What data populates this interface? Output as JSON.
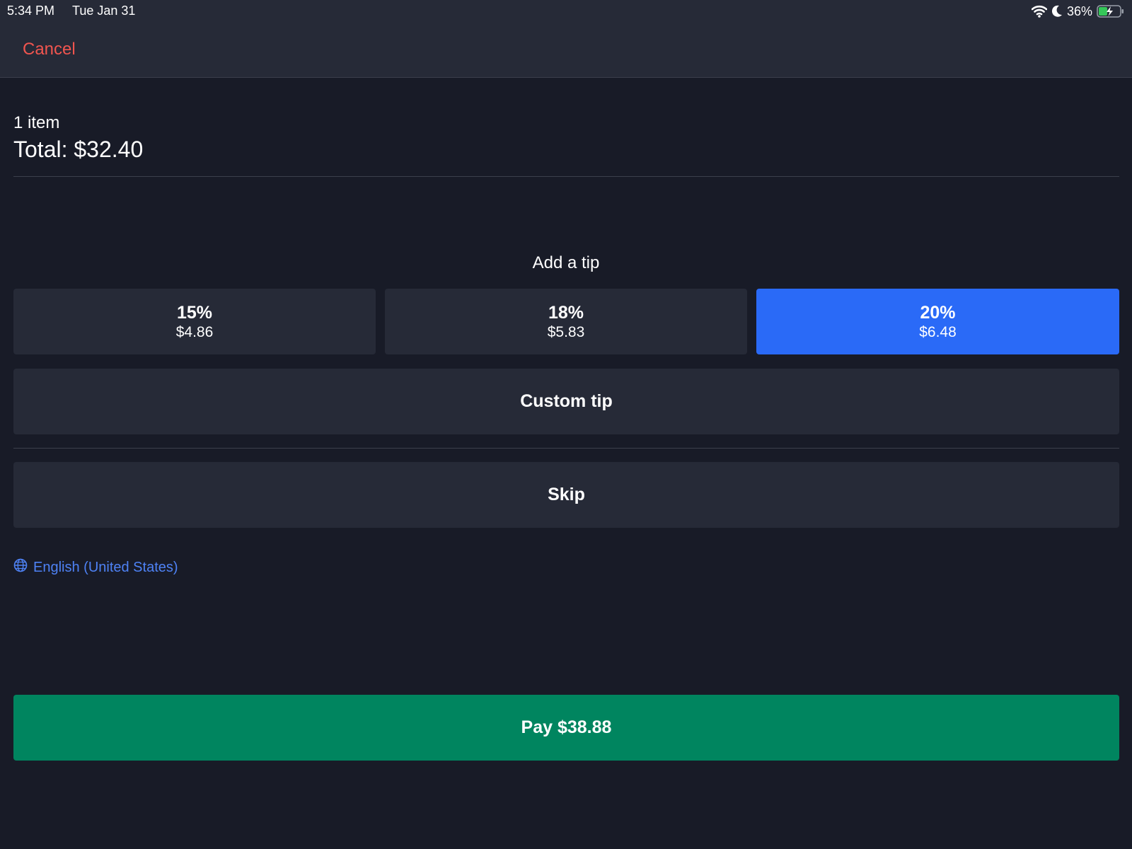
{
  "status_bar": {
    "time": "5:34 PM",
    "date": "Tue Jan 31",
    "battery_percent": "36%",
    "icons": [
      "wifi-icon",
      "moon-icon",
      "battery-charging-icon"
    ]
  },
  "header": {
    "cancel_label": "Cancel"
  },
  "summary": {
    "item_count": "1 item",
    "total_label": "Total:",
    "total_value": "$32.40"
  },
  "tip": {
    "heading": "Add a tip",
    "options": [
      {
        "percent": "15%",
        "amount": "$4.86",
        "selected": false
      },
      {
        "percent": "18%",
        "amount": "$5.83",
        "selected": false
      },
      {
        "percent": "20%",
        "amount": "$6.48",
        "selected": true
      }
    ],
    "custom_label": "Custom tip",
    "skip_label": "Skip"
  },
  "language": {
    "label": "English (United States)",
    "icon": "globe-icon"
  },
  "pay": {
    "label": "Pay $38.88"
  },
  "colors": {
    "background": "#181b27",
    "surface": "#262a37",
    "selected": "#2a6af7",
    "cancel": "#f0554f",
    "link": "#4e82f5",
    "pay": "#00855f"
  }
}
